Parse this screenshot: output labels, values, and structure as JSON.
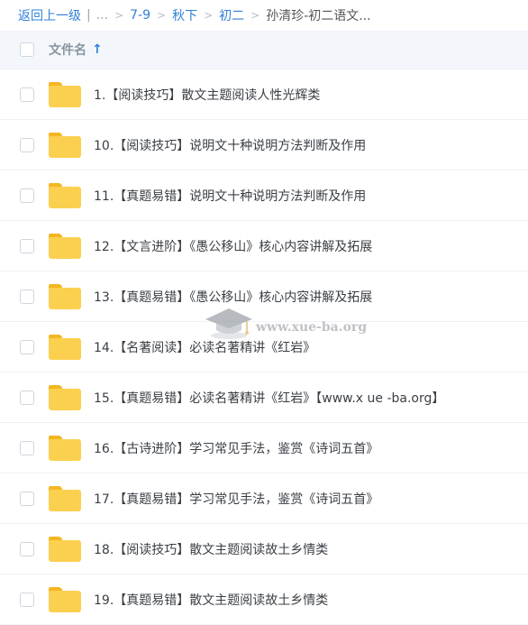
{
  "breadcrumb": {
    "back": "返回上一级",
    "divider": "|",
    "ellipsis": "...",
    "sep": ">",
    "path": [
      "7-9",
      "秋下",
      "初二"
    ],
    "current": "孙清珍-初二语文..."
  },
  "header": {
    "title": "文件名",
    "sort_arrow": "↑"
  },
  "files": [
    "1.【阅读技巧】散文主题阅读人性光辉类",
    "10.【阅读技巧】说明文十种说明方法判断及作用",
    "11.【真题易错】说明文十种说明方法判断及作用",
    "12.【文言进阶】《愚公移山》核心内容讲解及拓展",
    "13.【真题易错】《愚公移山》核心内容讲解及拓展",
    "14.【名著阅读】必读名著精讲《红岩》",
    "15.【真题易错】必读名著精讲《红岩》【www.x ue -ba.org】",
    "16.【古诗进阶】学习常见手法，鉴赏《诗词五首》",
    "17.【真题易错】学习常见手法，鉴赏《诗词五首》",
    "18.【阅读技巧】散文主题阅读故土乡情类",
    "19.【真题易错】散文主题阅读故土乡情类"
  ],
  "watermark": {
    "text": "www.xue-ba.org",
    "icon": "graduation-cap-icon"
  },
  "colors": {
    "link": "#2f7fd8",
    "folder": "#fcd04f",
    "folder_tab": "#f3b623",
    "header_bg": "#f3f7fc"
  }
}
